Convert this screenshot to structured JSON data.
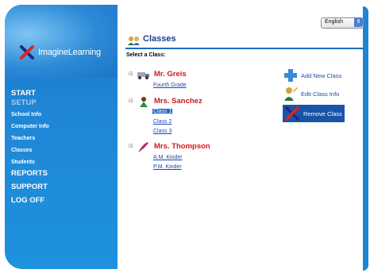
{
  "app": {
    "logo_text": "ImagineLearning"
  },
  "language": {
    "selected": "English"
  },
  "nav": {
    "items": [
      {
        "label": "START",
        "kind": "main"
      },
      {
        "label": "SETUP",
        "kind": "main-dim"
      },
      {
        "label": "School Info",
        "kind": "sub"
      },
      {
        "label": "Computer Info",
        "kind": "sub"
      },
      {
        "label": "Teachers",
        "kind": "sub"
      },
      {
        "label": "Classes",
        "kind": "sub"
      },
      {
        "label": "Students",
        "kind": "sub"
      },
      {
        "label": "REPORTS",
        "kind": "main"
      },
      {
        "label": "SUPPORT",
        "kind": "main"
      },
      {
        "label": "LOG OFF",
        "kind": "main"
      }
    ]
  },
  "page": {
    "title": "Classes",
    "select_label": "Select a Class:"
  },
  "teachers": [
    {
      "name": "Mr. Greis",
      "expander": "⊟",
      "icon": "truck-icon",
      "classes": [
        "Fourth Grade"
      ]
    },
    {
      "name": "Mrs. Sanchez",
      "expander": "⊟",
      "icon": "person-icon",
      "classes": [
        "Class 1",
        "Class 2",
        "Class 3"
      ],
      "selected_class": "Class 1"
    },
    {
      "name": "Mrs. Thompson",
      "expander": "⊟",
      "icon": "feather-icon",
      "classes": [
        "A.M. Kinder",
        "P.M. Kinder"
      ]
    }
  ],
  "actions": {
    "add": "Add New Class",
    "edit": "Edit Class Info",
    "remove": "Remove Class"
  },
  "colors": {
    "sidebar_blue": "#1e86d6",
    "teacher_red": "#d01818",
    "link_blue": "#1d49a9",
    "remove_bg": "#1a53a8"
  }
}
